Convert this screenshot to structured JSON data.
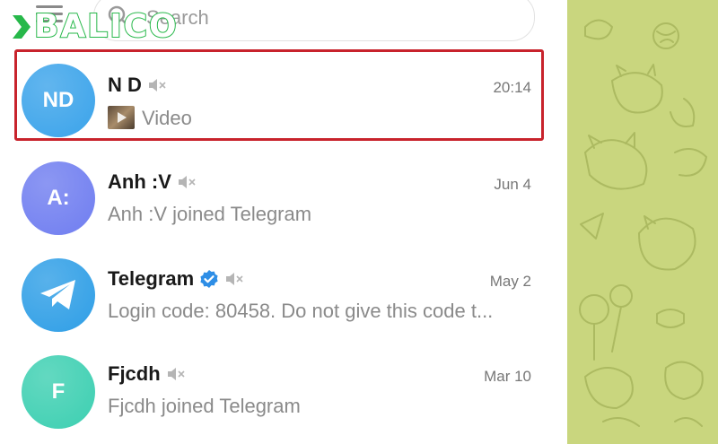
{
  "header": {
    "search_placeholder": "Search",
    "logo_text": "BALICO"
  },
  "chats": [
    {
      "avatar_initials": "ND",
      "avatar_color": "#3aa3ea",
      "name": "N D",
      "muted": true,
      "time": "20:14",
      "preview": "Video",
      "preview_has_media": true,
      "highlighted": true
    },
    {
      "avatar_initials": "A:",
      "avatar_color": "#6f7df0",
      "name": "Anh :V",
      "muted": true,
      "time": "Jun 4",
      "preview": "Anh :V joined Telegram"
    },
    {
      "avatar_initials": "",
      "avatar_color": "#2e9ee6",
      "name": "Telegram",
      "verified": true,
      "muted": true,
      "time": "May 2",
      "preview": "Login code: 80458. Do not give this code t..."
    },
    {
      "avatar_initials": "F",
      "avatar_color": "#3ccfb1",
      "name": "Fjcdh",
      "muted": true,
      "time": "Mar 10",
      "preview": "Fjcdh joined Telegram"
    }
  ],
  "colors": {
    "highlight_border": "#c8232c",
    "wallpaper": "#c9d67e",
    "logo_green": "#27b84a"
  }
}
